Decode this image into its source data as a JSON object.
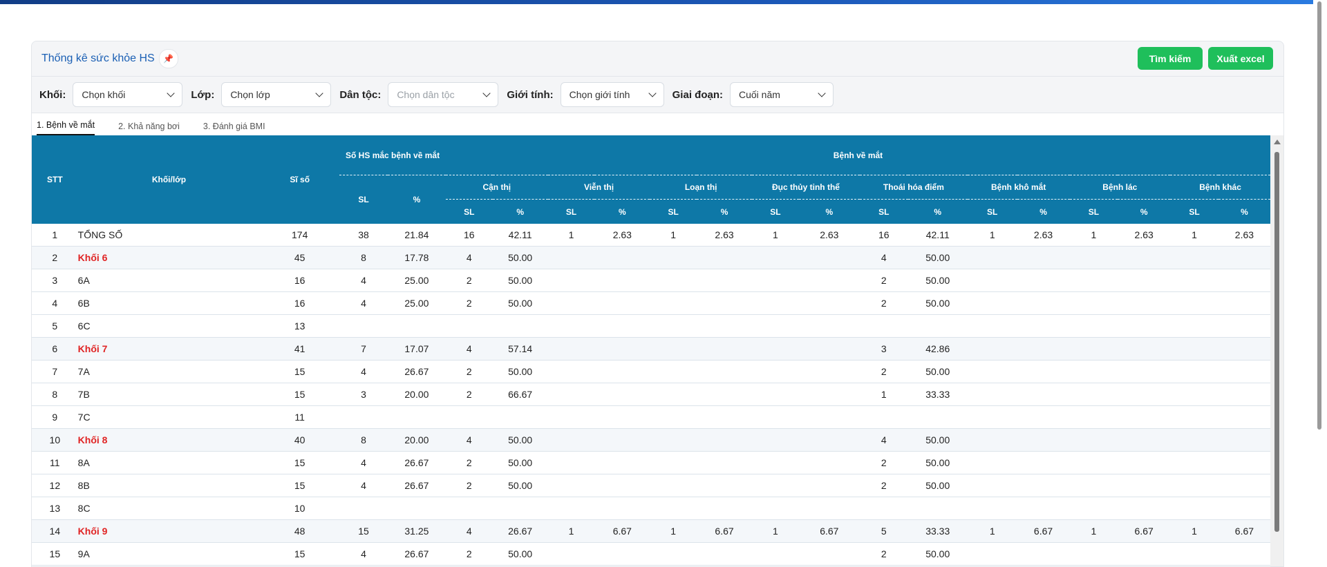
{
  "panel": {
    "title": "Thống kê sức khỏe HS"
  },
  "buttons": {
    "search": "Tìm kiếm",
    "export": "Xuất excel"
  },
  "filters": [
    {
      "label": "Khối:",
      "value": "Chọn khối",
      "placeholder": false
    },
    {
      "label": "Lớp:",
      "value": "Chọn lớp",
      "placeholder": false
    },
    {
      "label": "Dân tộc:",
      "value": "Chọn dân tộc",
      "placeholder": true
    },
    {
      "label": "Giới tính:",
      "value": "Chọn giới tính",
      "placeholder": false
    },
    {
      "label": "Giai đoạn:",
      "value": "Cuối năm",
      "placeholder": false
    }
  ],
  "tabs": [
    "1. Bệnh về mắt",
    "2. Khả năng bơi",
    "3. Đánh giá BMI"
  ],
  "header": {
    "stt": "STT",
    "class": "Khối/lớp",
    "siso": "Sĩ số",
    "affected": "Số HS mắc bệnh về mắt",
    "eye_diseases": "Bệnh về mắt",
    "sl": "SL",
    "pct": "%",
    "diseases": [
      "Cận thị",
      "Viễn thị",
      "Loạn thị",
      "Đục thủy tinh thể",
      "Thoái hóa điểm",
      "Bệnh khô mắt",
      "Bệnh lác",
      "Bệnh khác"
    ]
  },
  "rows": [
    {
      "stt": "1",
      "name": "TỔNG SỐ",
      "grade": false,
      "siso": "174",
      "sl": "38",
      "pct": "21.84",
      "d": [
        [
          "16",
          "42.11"
        ],
        [
          "1",
          "2.63"
        ],
        [
          "1",
          "2.63"
        ],
        [
          "1",
          "2.63"
        ],
        [
          "16",
          "42.11"
        ],
        [
          "1",
          "2.63"
        ],
        [
          "1",
          "2.63"
        ],
        [
          "1",
          "2.63"
        ]
      ]
    },
    {
      "stt": "2",
      "name": "Khối 6",
      "grade": true,
      "siso": "45",
      "sl": "8",
      "pct": "17.78",
      "d": [
        [
          "4",
          "50.00"
        ],
        [
          "",
          ""
        ],
        [
          "",
          ""
        ],
        [
          "",
          ""
        ],
        [
          "4",
          "50.00"
        ],
        [
          "",
          ""
        ],
        [
          "",
          ""
        ],
        [
          "",
          ""
        ]
      ]
    },
    {
      "stt": "3",
      "name": "6A",
      "grade": false,
      "siso": "16",
      "sl": "4",
      "pct": "25.00",
      "d": [
        [
          "2",
          "50.00"
        ],
        [
          "",
          ""
        ],
        [
          "",
          ""
        ],
        [
          "",
          ""
        ],
        [
          "2",
          "50.00"
        ],
        [
          "",
          ""
        ],
        [
          "",
          ""
        ],
        [
          "",
          ""
        ]
      ]
    },
    {
      "stt": "4",
      "name": "6B",
      "grade": false,
      "siso": "16",
      "sl": "4",
      "pct": "25.00",
      "d": [
        [
          "2",
          "50.00"
        ],
        [
          "",
          ""
        ],
        [
          "",
          ""
        ],
        [
          "",
          ""
        ],
        [
          "2",
          "50.00"
        ],
        [
          "",
          ""
        ],
        [
          "",
          ""
        ],
        [
          "",
          ""
        ]
      ]
    },
    {
      "stt": "5",
      "name": "6C",
      "grade": false,
      "siso": "13",
      "sl": "",
      "pct": "",
      "d": [
        [
          "",
          ""
        ],
        [
          "",
          ""
        ],
        [
          "",
          ""
        ],
        [
          "",
          ""
        ],
        [
          "",
          ""
        ],
        [
          "",
          ""
        ],
        [
          "",
          ""
        ],
        [
          "",
          ""
        ]
      ]
    },
    {
      "stt": "6",
      "name": "Khối 7",
      "grade": true,
      "siso": "41",
      "sl": "7",
      "pct": "17.07",
      "d": [
        [
          "4",
          "57.14"
        ],
        [
          "",
          ""
        ],
        [
          "",
          ""
        ],
        [
          "",
          ""
        ],
        [
          "3",
          "42.86"
        ],
        [
          "",
          ""
        ],
        [
          "",
          ""
        ],
        [
          "",
          ""
        ]
      ]
    },
    {
      "stt": "7",
      "name": "7A",
      "grade": false,
      "siso": "15",
      "sl": "4",
      "pct": "26.67",
      "d": [
        [
          "2",
          "50.00"
        ],
        [
          "",
          ""
        ],
        [
          "",
          ""
        ],
        [
          "",
          ""
        ],
        [
          "2",
          "50.00"
        ],
        [
          "",
          ""
        ],
        [
          "",
          ""
        ],
        [
          "",
          ""
        ]
      ]
    },
    {
      "stt": "8",
      "name": "7B",
      "grade": false,
      "siso": "15",
      "sl": "3",
      "pct": "20.00",
      "d": [
        [
          "2",
          "66.67"
        ],
        [
          "",
          ""
        ],
        [
          "",
          ""
        ],
        [
          "",
          ""
        ],
        [
          "1",
          "33.33"
        ],
        [
          "",
          ""
        ],
        [
          "",
          ""
        ],
        [
          "",
          ""
        ]
      ]
    },
    {
      "stt": "9",
      "name": "7C",
      "grade": false,
      "siso": "11",
      "sl": "",
      "pct": "",
      "d": [
        [
          "",
          ""
        ],
        [
          "",
          ""
        ],
        [
          "",
          ""
        ],
        [
          "",
          ""
        ],
        [
          "",
          ""
        ],
        [
          "",
          ""
        ],
        [
          "",
          ""
        ],
        [
          "",
          ""
        ]
      ]
    },
    {
      "stt": "10",
      "name": "Khối 8",
      "grade": true,
      "siso": "40",
      "sl": "8",
      "pct": "20.00",
      "d": [
        [
          "4",
          "50.00"
        ],
        [
          "",
          ""
        ],
        [
          "",
          ""
        ],
        [
          "",
          ""
        ],
        [
          "4",
          "50.00"
        ],
        [
          "",
          ""
        ],
        [
          "",
          ""
        ],
        [
          "",
          ""
        ]
      ]
    },
    {
      "stt": "11",
      "name": "8A",
      "grade": false,
      "siso": "15",
      "sl": "4",
      "pct": "26.67",
      "d": [
        [
          "2",
          "50.00"
        ],
        [
          "",
          ""
        ],
        [
          "",
          ""
        ],
        [
          "",
          ""
        ],
        [
          "2",
          "50.00"
        ],
        [
          "",
          ""
        ],
        [
          "",
          ""
        ],
        [
          "",
          ""
        ]
      ]
    },
    {
      "stt": "12",
      "name": "8B",
      "grade": false,
      "siso": "15",
      "sl": "4",
      "pct": "26.67",
      "d": [
        [
          "2",
          "50.00"
        ],
        [
          "",
          ""
        ],
        [
          "",
          ""
        ],
        [
          "",
          ""
        ],
        [
          "2",
          "50.00"
        ],
        [
          "",
          ""
        ],
        [
          "",
          ""
        ],
        [
          "",
          ""
        ]
      ]
    },
    {
      "stt": "13",
      "name": "8C",
      "grade": false,
      "siso": "10",
      "sl": "",
      "pct": "",
      "d": [
        [
          "",
          ""
        ],
        [
          "",
          ""
        ],
        [
          "",
          ""
        ],
        [
          "",
          ""
        ],
        [
          "",
          ""
        ],
        [
          "",
          ""
        ],
        [
          "",
          ""
        ],
        [
          "",
          ""
        ]
      ]
    },
    {
      "stt": "14",
      "name": "Khối 9",
      "grade": true,
      "siso": "48",
      "sl": "15",
      "pct": "31.25",
      "d": [
        [
          "4",
          "26.67"
        ],
        [
          "1",
          "6.67"
        ],
        [
          "1",
          "6.67"
        ],
        [
          "1",
          "6.67"
        ],
        [
          "5",
          "33.33"
        ],
        [
          "1",
          "6.67"
        ],
        [
          "1",
          "6.67"
        ],
        [
          "1",
          "6.67"
        ]
      ]
    },
    {
      "stt": "15",
      "name": "9A",
      "grade": false,
      "siso": "15",
      "sl": "4",
      "pct": "26.67",
      "d": [
        [
          "2",
          "50.00"
        ],
        [
          "",
          ""
        ],
        [
          "",
          ""
        ],
        [
          "",
          ""
        ],
        [
          "2",
          "50.00"
        ],
        [
          "",
          ""
        ],
        [
          "",
          ""
        ],
        [
          "",
          ""
        ]
      ]
    }
  ]
}
